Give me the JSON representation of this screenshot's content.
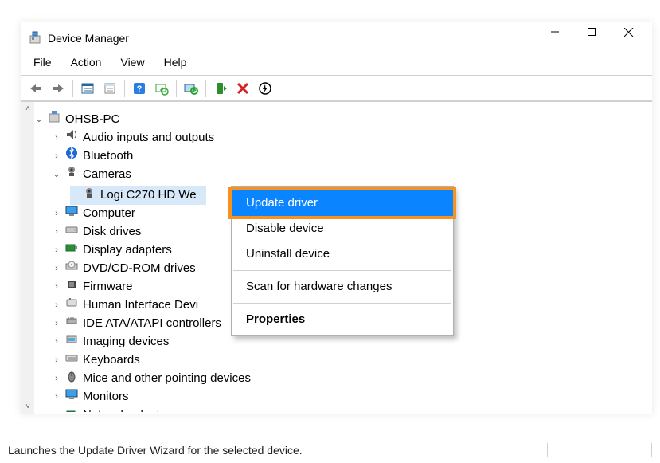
{
  "titlebar": {
    "title": "Device Manager"
  },
  "menubar": {
    "items": [
      "File",
      "Action",
      "View",
      "Help"
    ]
  },
  "status": {
    "text": "Launches the Update Driver Wizard for the selected device."
  },
  "tree": {
    "root": {
      "label": "OHSB-PC",
      "expanded": true
    },
    "children": [
      {
        "label": "Audio inputs and outputs",
        "expanded": false,
        "icon": "audio"
      },
      {
        "label": "Bluetooth",
        "expanded": false,
        "icon": "bluetooth"
      },
      {
        "label": "Cameras",
        "expanded": true,
        "icon": "camera",
        "children": [
          {
            "label": "Logi C270 HD We",
            "selected": true,
            "icon": "camera"
          }
        ]
      },
      {
        "label": "Computer",
        "expanded": false,
        "icon": "computer"
      },
      {
        "label": "Disk drives",
        "expanded": false,
        "icon": "disk"
      },
      {
        "label": "Display adapters",
        "expanded": false,
        "icon": "display"
      },
      {
        "label": "DVD/CD-ROM drives",
        "expanded": false,
        "icon": "cd"
      },
      {
        "label": "Firmware",
        "expanded": false,
        "icon": "firmware"
      },
      {
        "label": "Human Interface Devi",
        "expanded": false,
        "icon": "hid"
      },
      {
        "label": "IDE ATA/ATAPI controllers",
        "expanded": false,
        "icon": "ide"
      },
      {
        "label": "Imaging devices",
        "expanded": false,
        "icon": "imaging"
      },
      {
        "label": "Keyboards",
        "expanded": false,
        "icon": "keyboard"
      },
      {
        "label": "Mice and other pointing devices",
        "expanded": false,
        "icon": "mouse"
      },
      {
        "label": "Monitors",
        "expanded": false,
        "icon": "monitor"
      },
      {
        "label": "Network adapters",
        "expanded": true,
        "icon": "network"
      }
    ]
  },
  "context_menu": {
    "items": [
      {
        "label": "Update driver",
        "highlight": true
      },
      {
        "label": "Disable device"
      },
      {
        "label": "Uninstall device"
      },
      {
        "sep": true
      },
      {
        "label": "Scan for hardware changes"
      },
      {
        "sep": true
      },
      {
        "label": "Properties",
        "bold": true
      }
    ]
  },
  "accent_highlight": "#f7921e",
  "menu_highlight": "#0a84ff"
}
